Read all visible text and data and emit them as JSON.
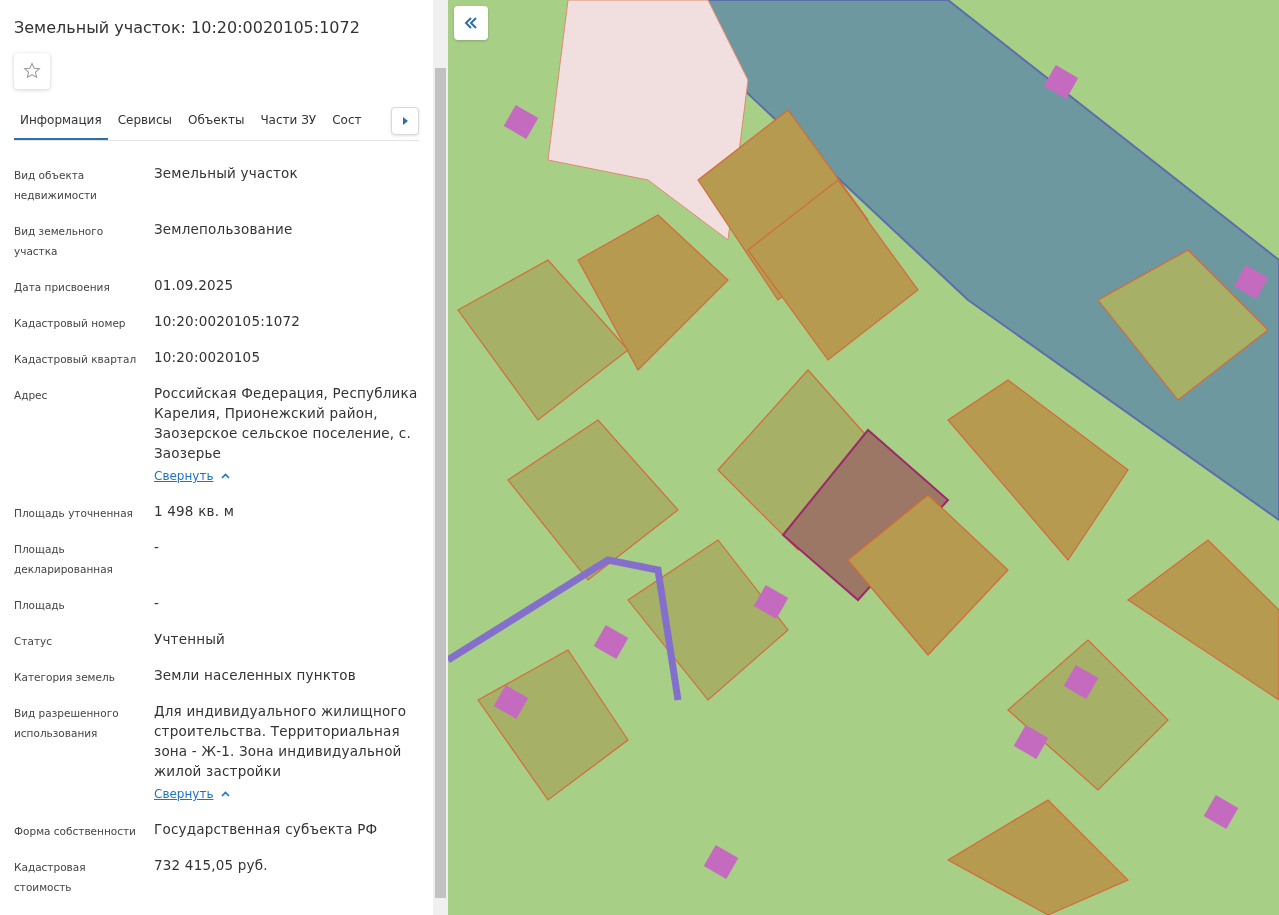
{
  "panel": {
    "title": "Земельный участок: 10:20:0020105:1072",
    "favorite": false,
    "tabs": [
      {
        "label": "Информация",
        "selected": true
      },
      {
        "label": "Сервисы",
        "selected": false
      },
      {
        "label": "Объекты",
        "selected": false
      },
      {
        "label": "Части ЗУ",
        "selected": false
      },
      {
        "label": "Сост",
        "selected": false
      }
    ],
    "fields": [
      {
        "label": "Вид объекта недвижимости",
        "value": "Земельный участок"
      },
      {
        "label": "Вид земельного участка",
        "value": "Землепользование"
      },
      {
        "label": "Дата присвоения",
        "value": "01.09.2025"
      },
      {
        "label": "Кадастровый номер",
        "value": "10:20:0020105:1072"
      },
      {
        "label": "Кадастровый квартал",
        "value": "10:20:0020105"
      },
      {
        "label": "Адрес",
        "value": "Российская Федерация, Республика Карелия, Прионежский район, Заозерское сельское поселение, с. Заозерье",
        "toggle": "Свернуть"
      },
      {
        "label": "Площадь уточненная",
        "value": "1 498 кв. м"
      },
      {
        "label": "Площадь декларированная",
        "value": "-"
      },
      {
        "label": "Площадь",
        "value": "-"
      },
      {
        "label": "Статус",
        "value": "Учтенный"
      },
      {
        "label": "Категория земель",
        "value": "Земли населенных пунктов"
      },
      {
        "label": "Вид разрешенного использования",
        "value": "Для индивидуального жилищного строительства. Территориальная зона - Ж-1. Зона индивидуальной жилой застройки",
        "toggle": "Свернуть"
      },
      {
        "label": "Форма собственности",
        "value": "Государственная субъекта РФ"
      },
      {
        "label": "Кадастровая стоимость",
        "value": "732 415,05 руб."
      }
    ]
  }
}
